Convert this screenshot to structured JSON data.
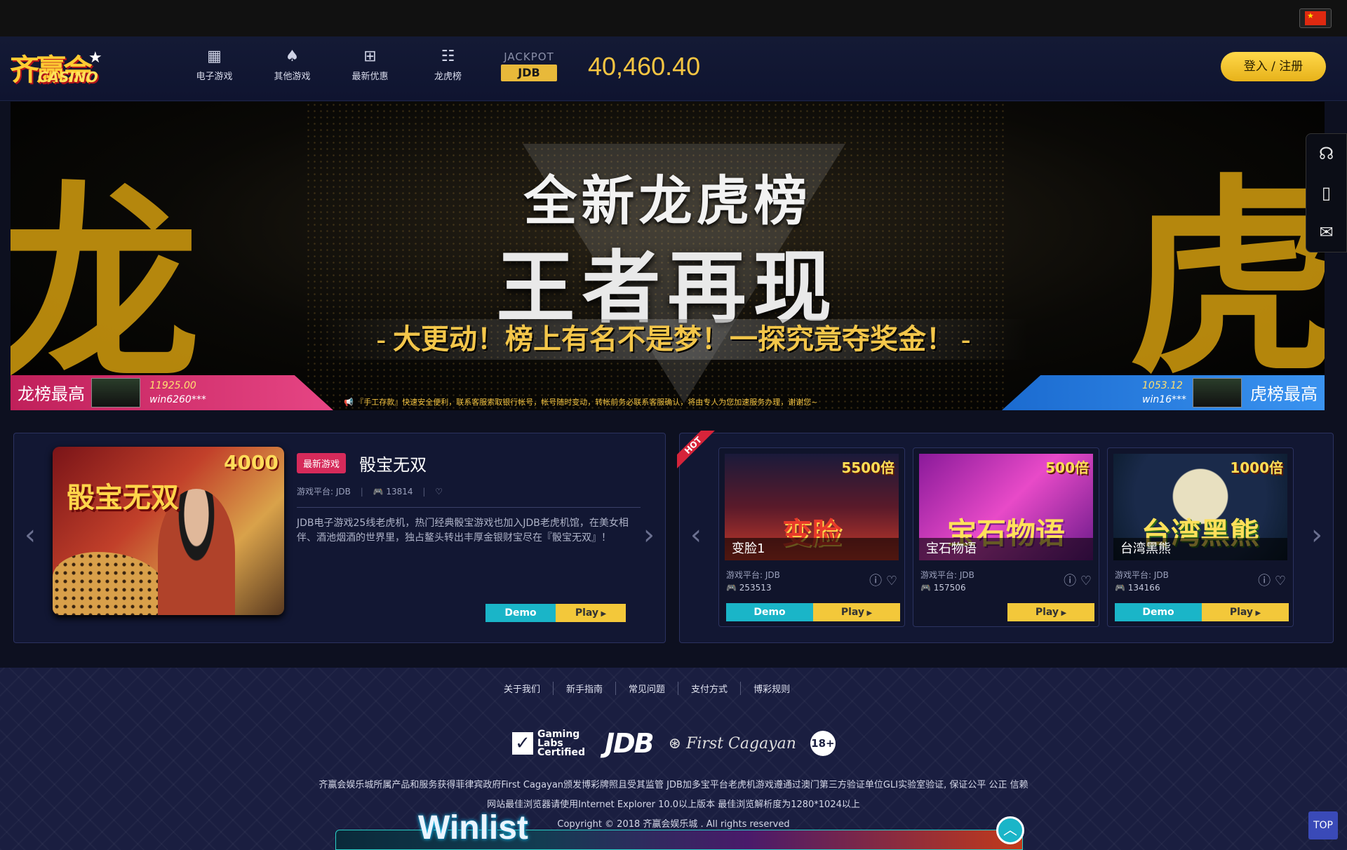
{
  "header": {
    "logo_cn": "齐赢会",
    "logo_en": "CASINO",
    "nav": [
      {
        "label": "电子游戏",
        "icon": "slot-machine-icon"
      },
      {
        "label": "其他游戏",
        "icon": "cards-icon"
      },
      {
        "label": "最新优惠",
        "icon": "gift-icon"
      },
      {
        "label": "龙虎榜",
        "icon": "leaderboard-icon"
      }
    ],
    "jackpot_label": "JACKPOT",
    "jackpot_provider": "JDB",
    "jackpot_amount": "40,460.40",
    "login_label": "登入 / 注册"
  },
  "banner": {
    "line1": "全新龙虎榜",
    "line2": "王者再现",
    "line3": "- 大更动！榜上有名不是梦！一探究竟夺奖金！ -",
    "left_char": "龙",
    "right_char": "虎",
    "left_rank": {
      "title": "龙榜最高",
      "amount": "11925.00",
      "user": "win6260***"
    },
    "right_rank": {
      "title": "虎榜最高",
      "amount": "1053.12",
      "user": "win16***"
    },
    "ticker": "『手工存款』快速安全便利，联系客服索取银行帐号，帐号随时变动，转帐前务必联系客服确认，将由专人为您加速服务办理，谢谢您~"
  },
  "featured": {
    "tag": "最新游戏",
    "name": "骰宝无双",
    "platform": "游戏平台: JDB",
    "players": "13814",
    "description": "JDB电子游戏25线老虎机，热门经典骰宝游戏也加入JDB老虎机馆，在美女相伴、酒池烟酒的世界里，独占鳌头转出丰厚金银财宝尽在『骰宝无双』！",
    "thumb_title": "骰宝无双",
    "thumb_mult": "4000",
    "demo_label": "Demo",
    "play_label": "Play"
  },
  "hot": {
    "ribbon": "HOT",
    "cards": [
      {
        "name": "变脸1",
        "mult": "5500倍",
        "art": "变脸",
        "platform": "游戏平台: JDB",
        "count": "253513",
        "has_demo": true
      },
      {
        "name": "宝石物语",
        "mult": "500倍",
        "art": "宝石物语",
        "platform": "游戏平台: JDB",
        "count": "157506",
        "has_demo": false
      },
      {
        "name": "台湾黑熊",
        "mult": "1000倍",
        "art": "台湾黑熊",
        "platform": "游戏平台: JDB",
        "count": "134166",
        "has_demo": true
      }
    ],
    "demo_label": "Demo",
    "play_label": "Play"
  },
  "footer": {
    "links": [
      "关于我们",
      "新手指南",
      "常见问题",
      "支付方式",
      "博彩规则"
    ],
    "gli": "Gaming Labs Certified",
    "jdb": "JDB",
    "first_cagayan": "First Cagayan",
    "age": "18+",
    "line1": "齐赢会娱乐城所属产品和服务获得菲律宾政府First Cagayan颁发博彩牌照且受其监管 JDB加多宝平台老虎机游戏遵通过澳门第三方验证单位GLI实验室验证, 保证公平 公正 信赖",
    "line2": "网站最佳浏览器请使用Internet Explorer 10.0以上版本 最佳浏览解析度为1280*1024以上",
    "copyright": "Copyright © 2018 齐赢会娱乐城 . All rights reserved"
  },
  "floating": {
    "winlist": "Winlist",
    "top": "TOP"
  }
}
